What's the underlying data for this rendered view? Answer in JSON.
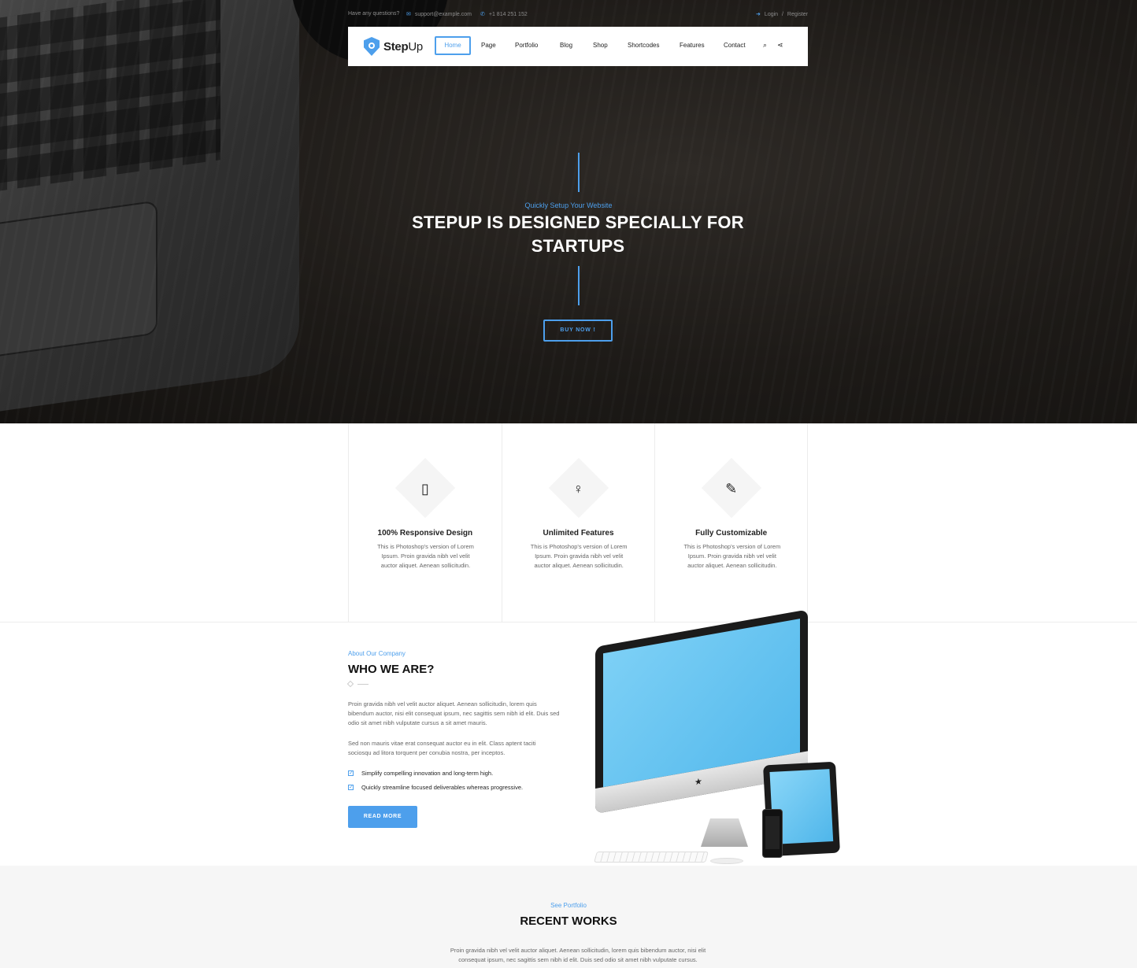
{
  "topbar": {
    "question": "Have any questions?",
    "email": "support@example.com",
    "phone": "+1 814 251 152",
    "login": "Login",
    "separator": "/",
    "register": "Register"
  },
  "header": {
    "brand_bold": "Step",
    "brand_light": "Up",
    "nav": [
      "Home",
      "Page",
      "Portfolio",
      "Blog",
      "Shop",
      "Shortcodes",
      "Features",
      "Contact"
    ],
    "active": "Home",
    "icons": [
      "search-icon",
      "share-icon"
    ]
  },
  "hero": {
    "subtitle": "Quickly Setup Your Website",
    "headline": "STEPUP IS DESIGNED SPECIALLY FOR STARTUPS",
    "cta": "BUY NOW !"
  },
  "features": [
    {
      "icon": "mobile-phone-icon",
      "title": "100% Responsive Design",
      "text": "This is Photoshop's version of Lorem Ipsum. Proin gravida nibh vel velit auctor aliquet. Aenean sollicitudin."
    },
    {
      "icon": "lightbulb-icon",
      "title": "Unlimited Features",
      "text": "This is Photoshop's version of Lorem Ipsum. Proin gravida nibh vel velit auctor aliquet. Aenean sollicitudin."
    },
    {
      "icon": "pencil-icon",
      "title": "Fully Customizable",
      "text": "This is Photoshop's version of Lorem Ipsum. Proin gravida nibh vel velit auctor aliquet. Aenean sollicitudin."
    }
  ],
  "about": {
    "kicker": "About Our Company",
    "title": "WHO WE ARE?",
    "para1": "Proin gravida nibh vel velit auctor aliquet. Aenean sollicitudin, lorem quis bibendum auctor, nisi elit consequat ipsum, nec sagittis sem nibh id elit. Duis sed odio sit amet nibh vulputate cursus a sit amet mauris.",
    "para2": "Sed non mauris vitae erat consequat auctor eu in elit. Class aptent taciti sociosqu ad litora torquent per conubia nostra, per inceptos.",
    "checks": [
      "Simplify compelling innovation and long-term high.",
      "Quickly streamline focused deliverables whereas progressive."
    ],
    "button": "READ MORE"
  },
  "works": {
    "kicker": "See Portfolio",
    "title": "RECENT WORKS",
    "text": "Proin gravida nibh vel velit auctor aliquet. Aenean sollicitudin, lorem quis bibendum auctor, nisi elit consequat ipsum, nec sagittis sem nibh id elit. Duis sed odio sit amet nibh vulputate cursus."
  },
  "colors": {
    "accent": "#4d9fec",
    "hero_bg": "#1d1a17",
    "section_bg": "#f6f6f6"
  }
}
